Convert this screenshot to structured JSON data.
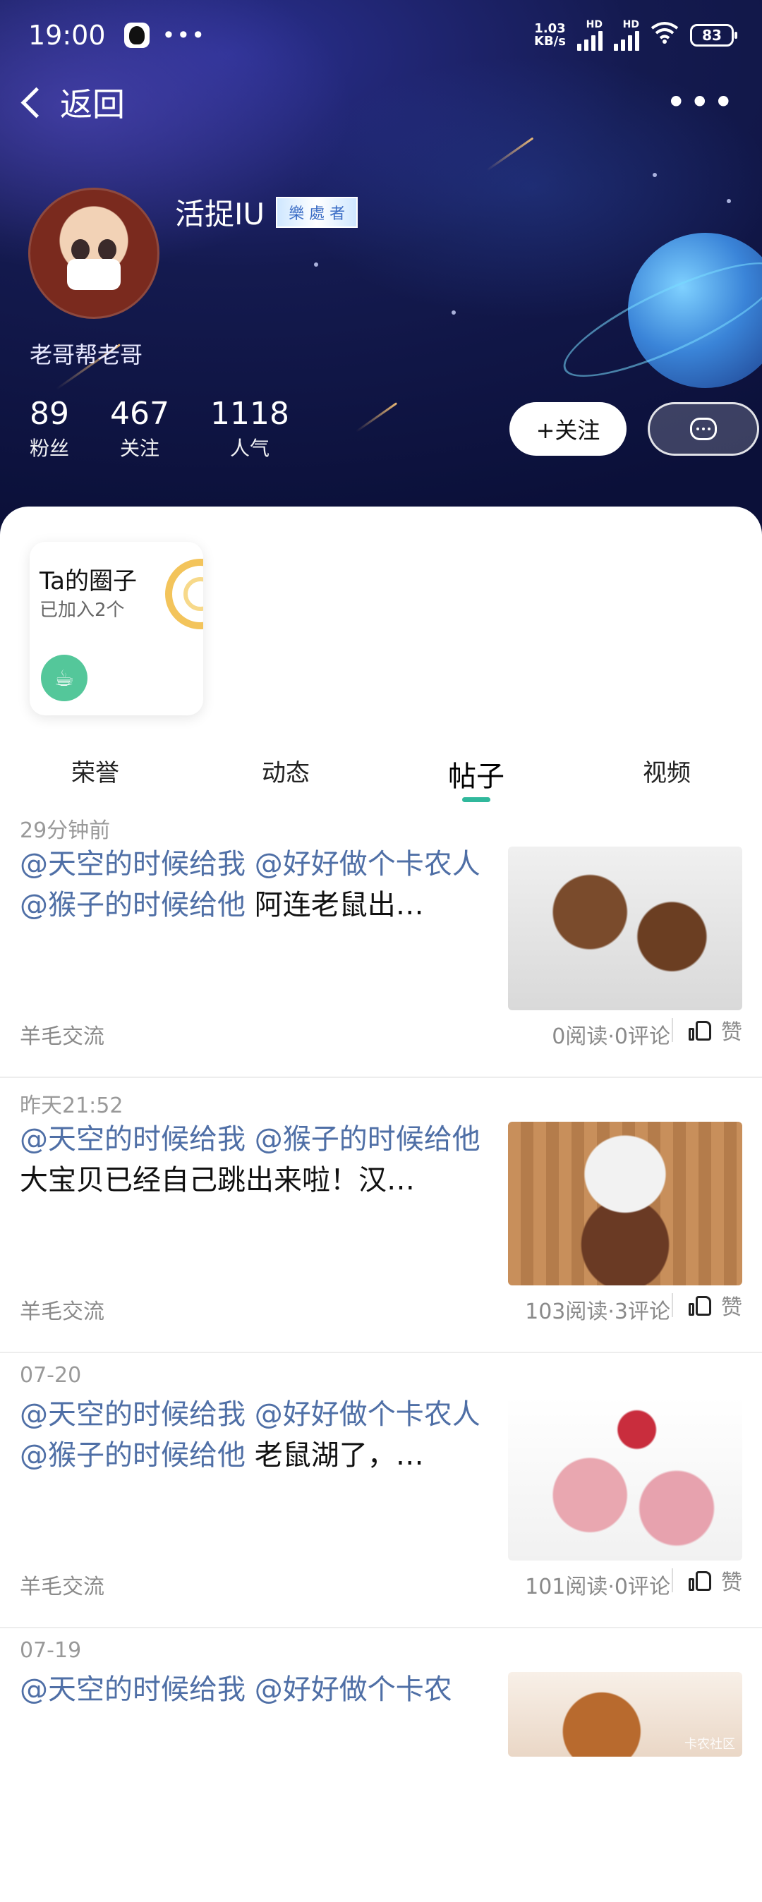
{
  "status_bar": {
    "time": "19:00",
    "net_speed_top": "1.03",
    "net_speed_bottom": "KB/s",
    "signal_1_label": "HD",
    "signal_2_label": "HD",
    "battery": "83"
  },
  "nav": {
    "back_label": "返回"
  },
  "profile": {
    "username": "活捉IU",
    "badge_text": "樂 處 者",
    "bio": "老哥帮老哥",
    "stats": [
      {
        "value": "89",
        "label": "粉丝"
      },
      {
        "value": "467",
        "label": "关注"
      },
      {
        "value": "1118",
        "label": "人气"
      }
    ],
    "follow_label": "+关注"
  },
  "circle_card": {
    "title": "Ta的圈子",
    "subtitle": "已加入2个"
  },
  "tabs": [
    {
      "label": "荣誉",
      "active": false
    },
    {
      "label": "动态",
      "active": false
    },
    {
      "label": "帖子",
      "active": true
    },
    {
      "label": "视频",
      "active": false
    }
  ],
  "posts": [
    {
      "time": "29分钟前",
      "mentions": "@天空的时候给我 @好好做个卡农人 @猴子的时候给他",
      "body": "阿连老鼠出…",
      "tag": "羊毛交流",
      "meta": "0阅读·0评论",
      "like_label": "赞"
    },
    {
      "time": "昨天21:52",
      "mentions": "@天空的时候给我 @猴子的时候给他",
      "body": "大宝贝已经自己跳出来啦！汉…",
      "tag": "羊毛交流",
      "meta": "103阅读·3评论",
      "like_label": "赞"
    },
    {
      "time": "07-20",
      "mentions": "@天空的时候给我 @好好做个卡农人 @猴子的时候给他",
      "body": "老鼠湖了，…",
      "tag": "羊毛交流",
      "meta": "101阅读·0评论",
      "like_label": "赞"
    },
    {
      "time": "07-19",
      "mentions": "@天空的时候给我 @好好做个卡农",
      "body": "",
      "tag": "",
      "meta": "",
      "like_label": "",
      "watermark": "卡农社区"
    }
  ],
  "colors": {
    "accent": "#30b89c",
    "mention": "#4f6fa6",
    "header_bg": "#141a4f",
    "circle_icon": "#54c79a"
  }
}
